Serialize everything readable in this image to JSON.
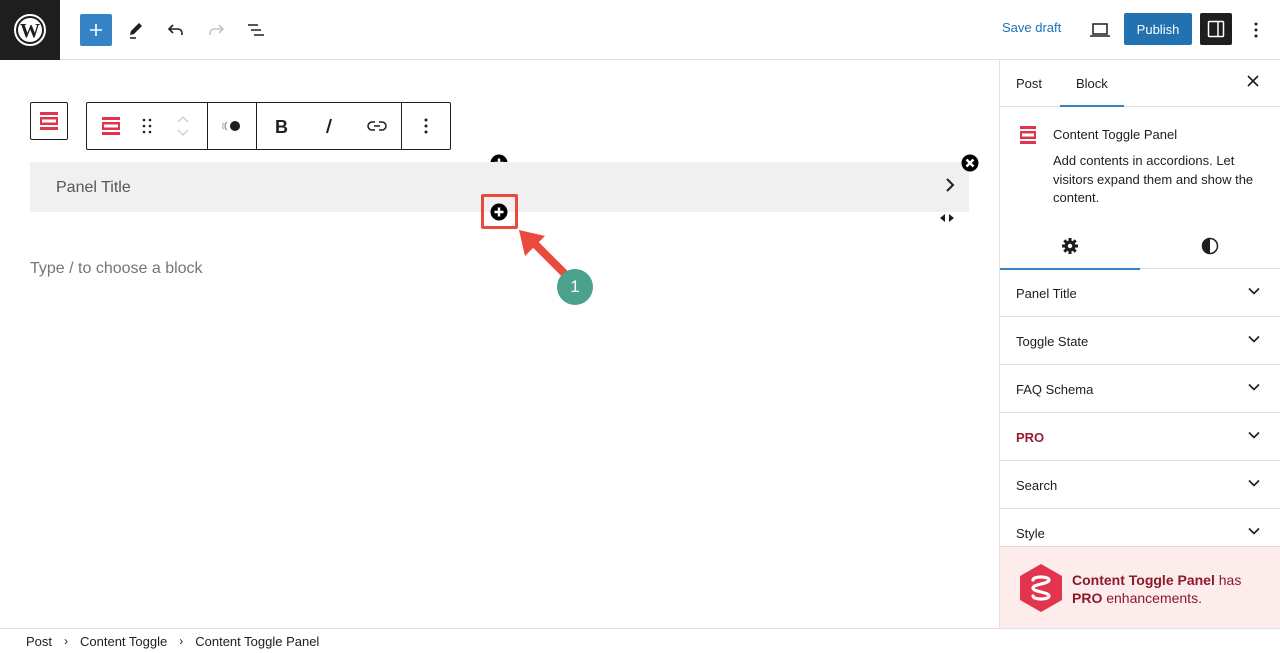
{
  "topbar": {
    "save_draft_label": "Save draft",
    "publish_label": "Publish"
  },
  "editor": {
    "panel_title": "Panel Title",
    "block_placeholder": "Type / to choose a block",
    "annotation_number": "1"
  },
  "sidebar": {
    "tabs": [
      {
        "label": "Post",
        "active": false
      },
      {
        "label": "Block",
        "active": true
      }
    ],
    "block_card": {
      "title": "Content Toggle Panel",
      "description": "Add contents in accordions. Let visitors expand them and show the content."
    },
    "sub_tabs": [
      {
        "icon": "gear-icon",
        "active": true
      },
      {
        "icon": "contrast-icon",
        "active": false
      }
    ],
    "accordion": [
      {
        "label": "Panel Title"
      },
      {
        "label": "Toggle State"
      },
      {
        "label": "FAQ Schema"
      },
      {
        "label": "PRO",
        "pro": true
      },
      {
        "label": "Search"
      },
      {
        "label": "Style"
      }
    ],
    "pro_notice": {
      "bold_part": "Content Toggle Panel",
      "mid": " has ",
      "pro": "PRO",
      "end": " enhancements."
    }
  },
  "breadcrumb": [
    "Post",
    "Content Toggle",
    "Content Toggle Panel"
  ],
  "colors": {
    "accent": "#2271b1",
    "brand_red": "#e2344c",
    "highlight_red": "#e94a3b",
    "badge_green": "#4aa18c",
    "pro_text": "#9b1c31"
  }
}
